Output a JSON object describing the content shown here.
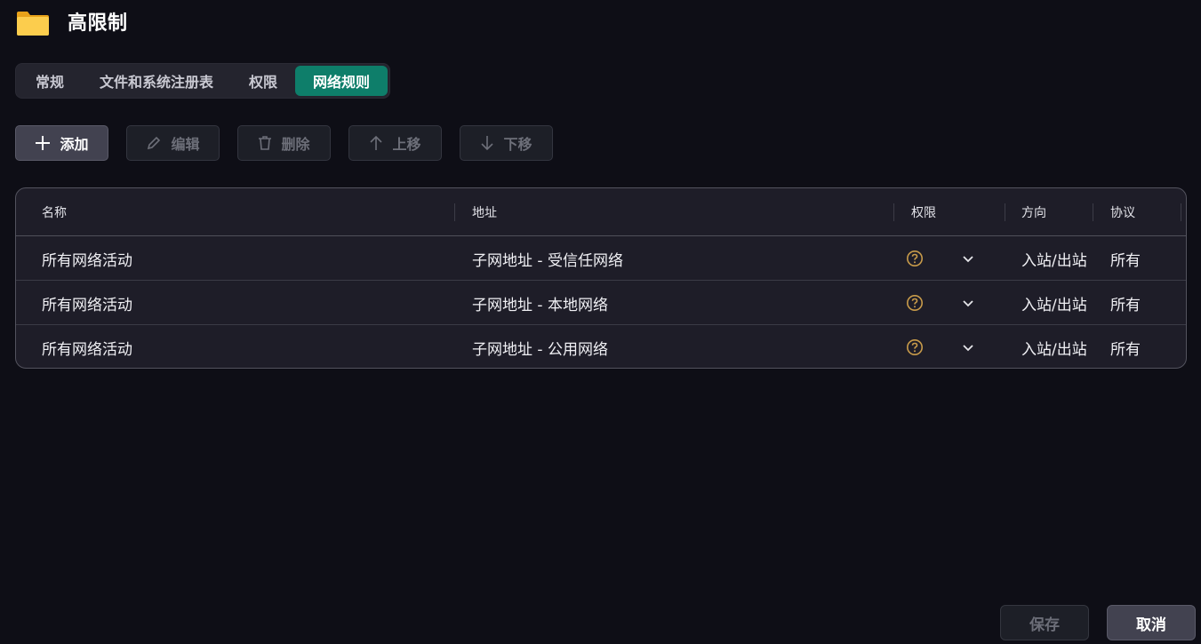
{
  "header": {
    "title": "高限制",
    "icon": "folder-icon"
  },
  "tabs": [
    {
      "label": "常规",
      "active": false
    },
    {
      "label": "文件和系统注册表",
      "active": false
    },
    {
      "label": "权限",
      "active": false
    },
    {
      "label": "网络规则",
      "active": true
    }
  ],
  "toolbar": {
    "add": "添加",
    "edit": "编辑",
    "delete": "删除",
    "move_up": "上移",
    "move_down": "下移"
  },
  "table": {
    "columns": [
      "名称",
      "地址",
      "权限",
      "方向",
      "协议"
    ],
    "rows": [
      {
        "name": "所有网络活动",
        "address": "子网地址 - 受信任网络",
        "permission": "question-icon",
        "direction": "入站/出站",
        "protocol": "所有"
      },
      {
        "name": "所有网络活动",
        "address": "子网地址 - 本地网络",
        "permission": "question-icon",
        "direction": "入站/出站",
        "protocol": "所有"
      },
      {
        "name": "所有网络活动",
        "address": "子网地址 - 公用网络",
        "permission": "question-icon",
        "direction": "入站/出站",
        "protocol": "所有"
      }
    ]
  },
  "footer": {
    "save": "保存",
    "cancel": "取消"
  },
  "colors": {
    "accent": "#0e7e6a",
    "background": "#0e0e16",
    "question": "#c89b4a"
  }
}
